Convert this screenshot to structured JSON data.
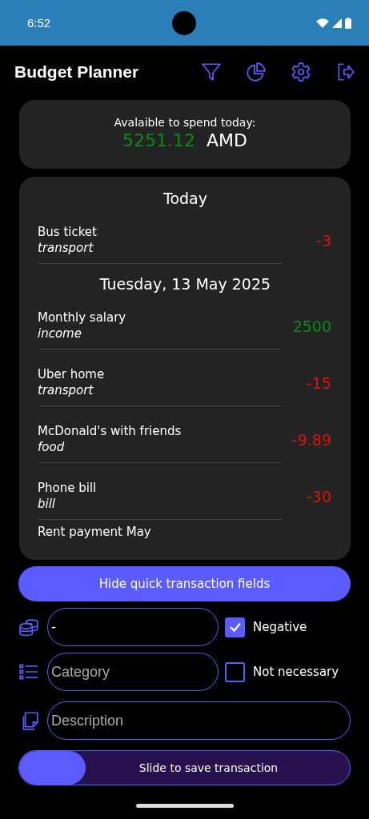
{
  "status_bar": {
    "time": "6:52"
  },
  "header": {
    "title": "Budget Planner"
  },
  "balance": {
    "label": "Avalaible to spend today:",
    "amount": "5251.12",
    "currency": "AMD"
  },
  "transactions": {
    "groups": [
      {
        "title": "Today",
        "items": [
          {
            "name": "Bus ticket",
            "category": "transport",
            "amount": "-3",
            "kind": "expense"
          }
        ]
      },
      {
        "title": "Tuesday, 13 May 2025",
        "items": [
          {
            "name": "Monthly salary",
            "category": "income",
            "amount": "2500",
            "kind": "income"
          },
          {
            "name": "Uber home",
            "category": "transport",
            "amount": "-15",
            "kind": "expense"
          },
          {
            "name": "McDonald's with friends",
            "category": "food",
            "amount": "-9.89",
            "kind": "expense"
          },
          {
            "name": "Phone bill",
            "category": "bill",
            "amount": "-30",
            "kind": "expense"
          },
          {
            "name": "Rent payment May",
            "kind": "partial"
          }
        ]
      }
    ]
  },
  "toggle_button": {
    "label": "Hide quick transaction fields"
  },
  "form": {
    "amount": {
      "value": "-"
    },
    "category": {
      "placeholder": "Category"
    },
    "description": {
      "placeholder": "Description"
    },
    "checkboxes": [
      {
        "label": "Negative",
        "checked": true
      },
      {
        "label": "Not necessary",
        "checked": false
      }
    ]
  },
  "slider": {
    "label": "Slide to save transaction",
    "level": 0.2
  }
}
